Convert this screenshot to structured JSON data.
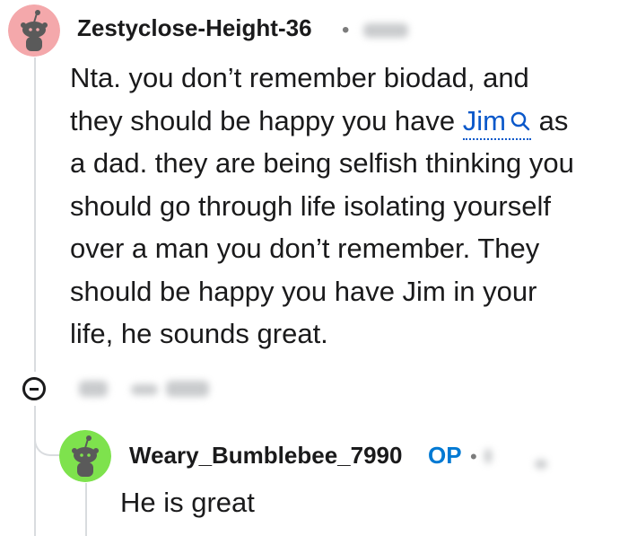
{
  "comments": [
    {
      "username": "Zestyclose-Height-36",
      "avatar_color": "#f4a8ab",
      "body_lines": [
        "Nta. you don’t remember biodad, and",
        "they should be happy you have",
        "as",
        "a dad. they are being selfish thinking you",
        "should go through life isolating yourself",
        "over a man you don’t remember. They",
        "should be happy you have Jim in your",
        "life, he sounds great."
      ],
      "keyword": "Jim"
    },
    {
      "username": "Weary_Bumblebee_7990",
      "op_label": "OP",
      "avatar_color": "#7ee24d",
      "body": "He is great"
    }
  ],
  "icons": {
    "search": "search-icon",
    "collapse": "collapse-icon",
    "avatar": "snoo-avatar-icon"
  },
  "colors": {
    "link": "#0a58ca",
    "op": "#0079d3",
    "thread_line": "#d9dcdf"
  }
}
